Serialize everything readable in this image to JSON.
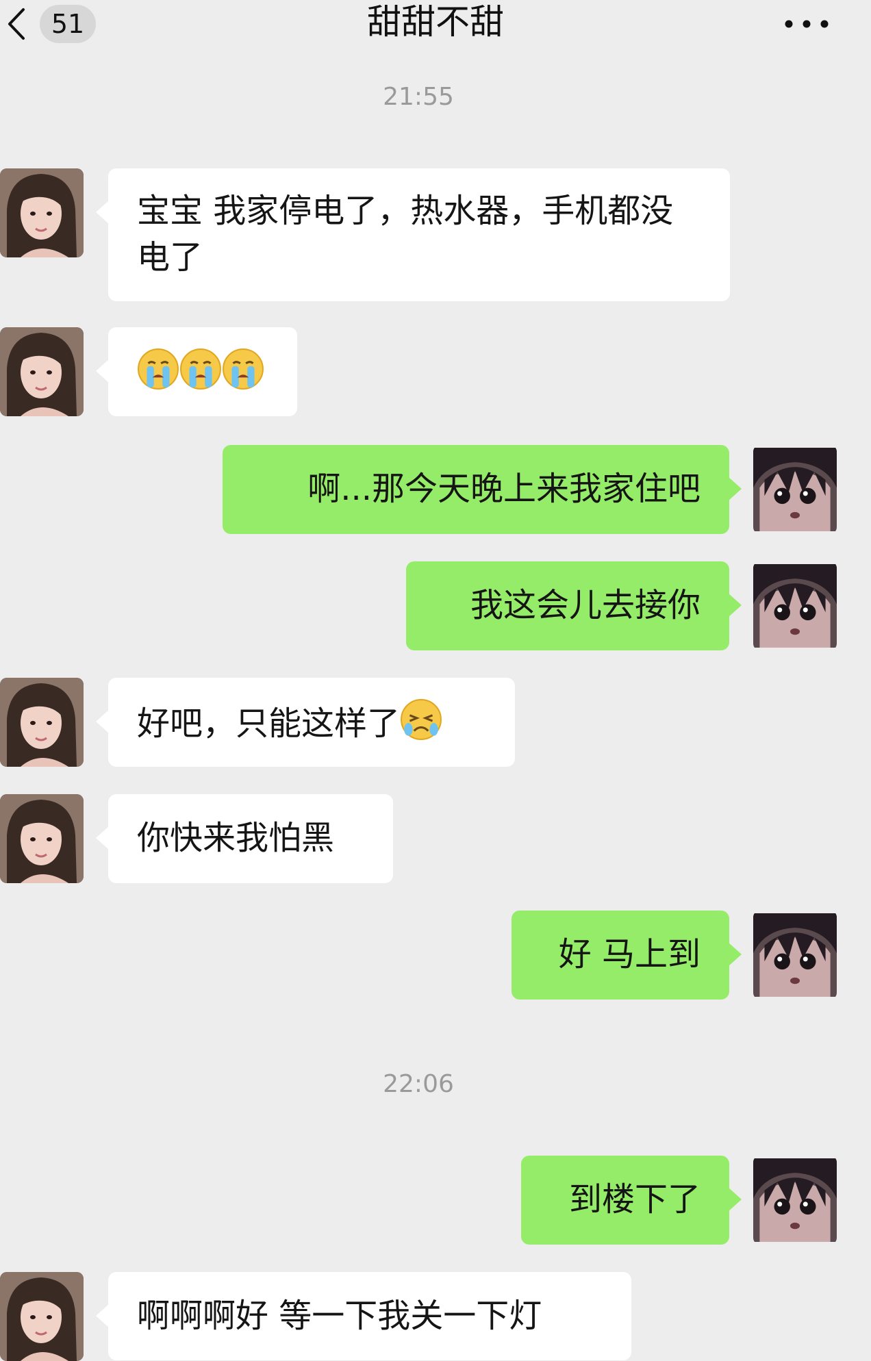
{
  "header": {
    "back_icon": "chevron-left-icon",
    "unread_count": "51",
    "title": "甜甜不甜",
    "more_icon": "ellipsis-icon"
  },
  "timestamps": [
    "21:55",
    "22:06"
  ],
  "messages": [
    {
      "side": "incoming",
      "text": "宝宝 我家停电了，热水器，手机都没电了"
    },
    {
      "side": "incoming",
      "emoji": [
        "loudly-crying-face-emoji",
        "loudly-crying-face-emoji",
        "loudly-crying-face-emoji"
      ]
    },
    {
      "side": "outgoing",
      "text": "啊...那今天晚上来我家住吧"
    },
    {
      "side": "outgoing",
      "text": "我这会儿去接你"
    },
    {
      "side": "incoming",
      "text": "好吧，只能这样了",
      "trailing_emoji": "crying-face-emoji"
    },
    {
      "side": "incoming",
      "text": "你快来我怕黑"
    },
    {
      "side": "outgoing",
      "text": "好 马上到"
    },
    {
      "side": "outgoing",
      "text": "到楼下了"
    },
    {
      "side": "incoming",
      "text": "啊啊啊好 等一下我关一下灯"
    }
  ],
  "colors": {
    "background": "#ededed",
    "incoming_bubble": "#ffffff",
    "outgoing_bubble": "#95ec69",
    "timestamp_text": "#9a9a9a",
    "badge_background": "#d7d7d7"
  }
}
